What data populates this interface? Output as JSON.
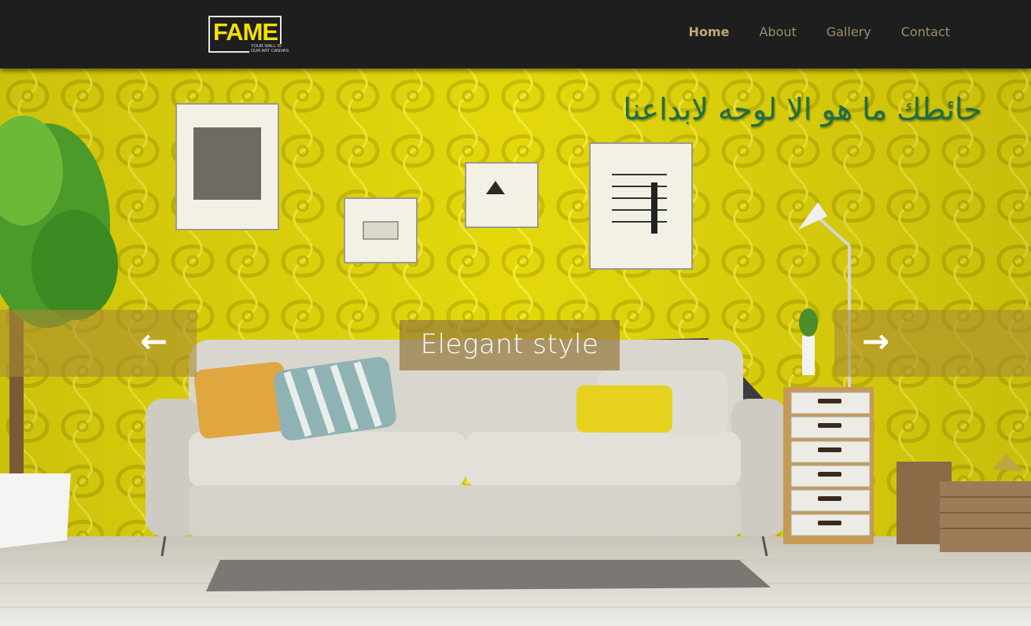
{
  "brand": {
    "logo_text": "FAME",
    "tagline": "YOUR WALL IS OUR ART CANVAS"
  },
  "nav": {
    "items": [
      {
        "label": "Home",
        "active": true
      },
      {
        "label": "About",
        "active": false
      },
      {
        "label": "Gallery",
        "active": false
      },
      {
        "label": "Contact",
        "active": false
      }
    ]
  },
  "hero": {
    "arabic_headline": "حائطك ما هو الا لوحه لابداعنا",
    "caption": "Elegant style",
    "prev_icon": "arrow-left-icon",
    "next_icon": "arrow-right-icon"
  },
  "colors": {
    "navbar_bg": "#1e1e1e",
    "nav_text": "#9e8d68",
    "nav_active": "#c0a878",
    "logo_yellow": "#f2e000",
    "wall_yellow": "#e8de10",
    "headline_green": "#1f6e45"
  }
}
